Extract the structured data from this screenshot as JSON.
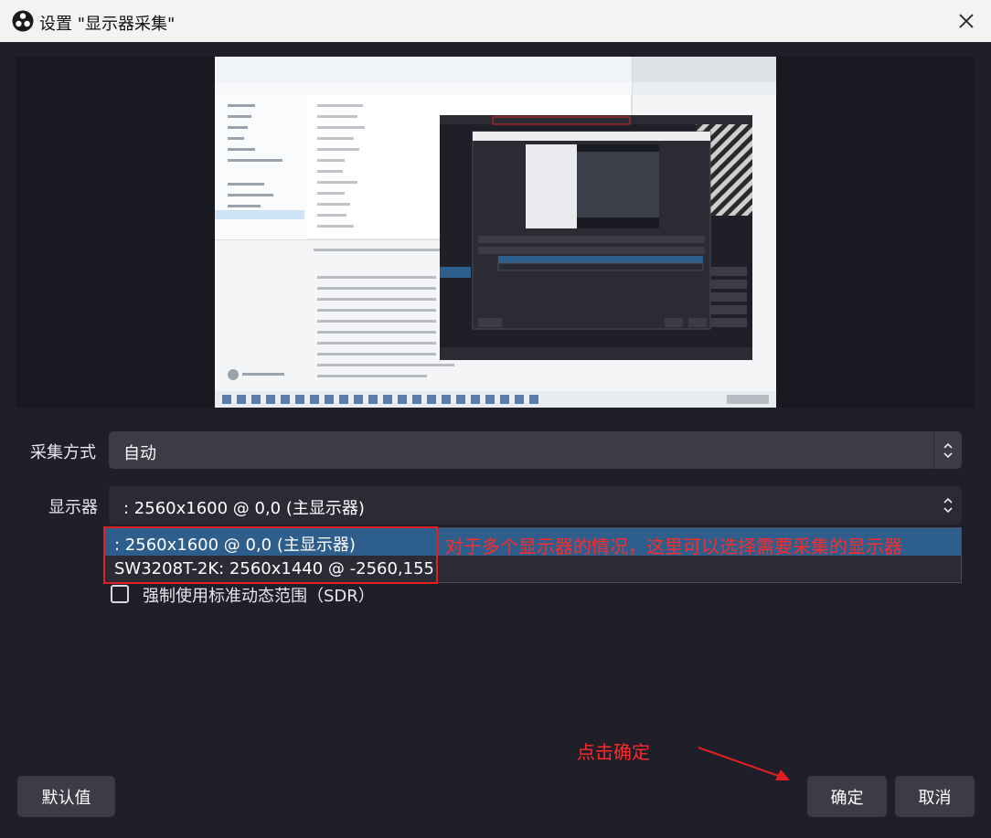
{
  "window": {
    "title": "设置 \"显示器采集\""
  },
  "capture_method": {
    "label": "采集方式",
    "value": "自动"
  },
  "display": {
    "label": "显示器",
    "value": ": 2560x1600 @ 0,0 (主显示器)",
    "options": [
      ": 2560x1600 @ 0,0 (主显示器)",
      "SW3208T-2K: 2560x1440 @ -2560,155"
    ]
  },
  "sdr_checkbox": {
    "label": "强制使用标准动态范围（SDR）",
    "checked": false
  },
  "annotations": {
    "dropdown_note": "对于多个显示器的情况，这里可以选择需要采集的显示器",
    "ok_note": "点击确定"
  },
  "buttons": {
    "defaults": "默认值",
    "ok": "确定",
    "cancel": "取消"
  },
  "colors": {
    "background": "#1e1f29",
    "control": "#3b3c46",
    "selection": "#2e5e8b",
    "annotation": "#ff2a2a"
  }
}
